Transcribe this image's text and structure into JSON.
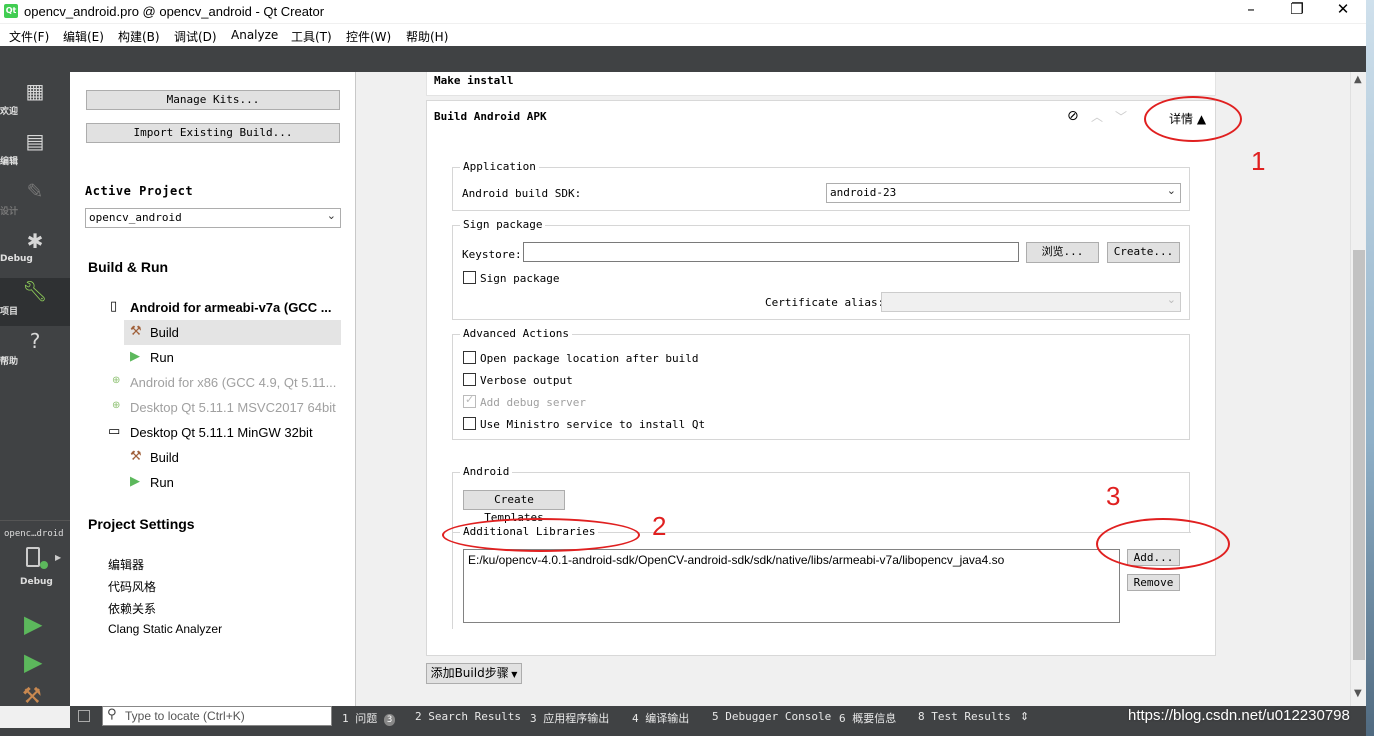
{
  "window": {
    "title": "opencv_android.pro @ opencv_android - Qt Creator",
    "app_icon": "Qt",
    "minimize": "–",
    "maximize": "❐",
    "close": "✕"
  },
  "menu": [
    "文件(F)",
    "编辑(E)",
    "构建(B)",
    "调试(D)",
    "Analyze",
    "工具(T)",
    "控件(W)",
    "帮助(H)"
  ],
  "modes": {
    "welcome": "欢迎",
    "edit": "编辑",
    "design": "设计",
    "debug": "Debug",
    "projects": "项目",
    "help": "帮助"
  },
  "kit_selector": {
    "project": "openc…droid",
    "mode": "Debug"
  },
  "left_panel": {
    "manage_kits": "Manage Kits...",
    "import_build": "Import Existing Build...",
    "active_project_heading": "Active Project",
    "active_project_value": "opencv_android",
    "build_run_heading": "Build & Run",
    "kits": [
      {
        "name": "Android for armeabi-v7a (GCC ..."
      },
      {
        "name": "Android for x86 (GCC 4.9, Qt 5.11..."
      },
      {
        "name": "Desktop Qt 5.11.1 MSVC2017 64bit"
      },
      {
        "name": "Desktop Qt 5.11.1 MinGW 32bit"
      }
    ],
    "build_label": "Build",
    "run_label": "Run",
    "project_settings_heading": "Project Settings",
    "settings_items": [
      "编辑器",
      "代码风格",
      "依赖关系",
      "Clang Static Analyzer"
    ]
  },
  "main": {
    "make_install": "Make install",
    "apk_title": "Build Android APK",
    "details_button": "详情 ▲",
    "application_group": "Application",
    "sdk_label": "Android build SDK:",
    "sdk_value": "android-23",
    "sign_group": "Sign package",
    "keystore_label": "Keystore:",
    "browse_button": "浏览...",
    "create_button": "Create...",
    "sign_package_checkbox": "Sign package",
    "cert_alias_label": "Certificate alias:",
    "advanced_group": "Advanced Actions",
    "open_location": "Open package location after build",
    "verbose_output": "Verbose output",
    "add_debug_server": "Add debug server",
    "use_ministro": "Use Ministro service to install Qt",
    "android_group": "Android",
    "create_templates": "Create Templates",
    "libraries_group": "Additional Libraries",
    "library_path": "E:/ku/opencv-4.0.1-android-sdk/OpenCV-android-sdk/sdk/native/libs/armeabi-v7a/libopencv_java4.so",
    "add_button": "Add...",
    "remove_button": "Remove",
    "add_build_step": "添加Build步骤",
    "annotations": [
      "1",
      "2",
      "3"
    ]
  },
  "statusbar": {
    "locator_placeholder": "Type to locate (Ctrl+K)",
    "panes": [
      {
        "num": "1",
        "label": "问题",
        "badge": "3"
      },
      {
        "num": "2",
        "label": "Search Results"
      },
      {
        "num": "3",
        "label": "应用程序输出"
      },
      {
        "num": "4",
        "label": "编译输出"
      },
      {
        "num": "5",
        "label": "Debugger Console"
      },
      {
        "num": "6",
        "label": "概要信息"
      },
      {
        "num": "8",
        "label": "Test Results"
      }
    ],
    "watermark": "https://blog.csdn.net/u012230798"
  },
  "colors": {
    "sidebar": "#404244",
    "annotation": "#e02020",
    "run_green": "#5cb85c"
  }
}
